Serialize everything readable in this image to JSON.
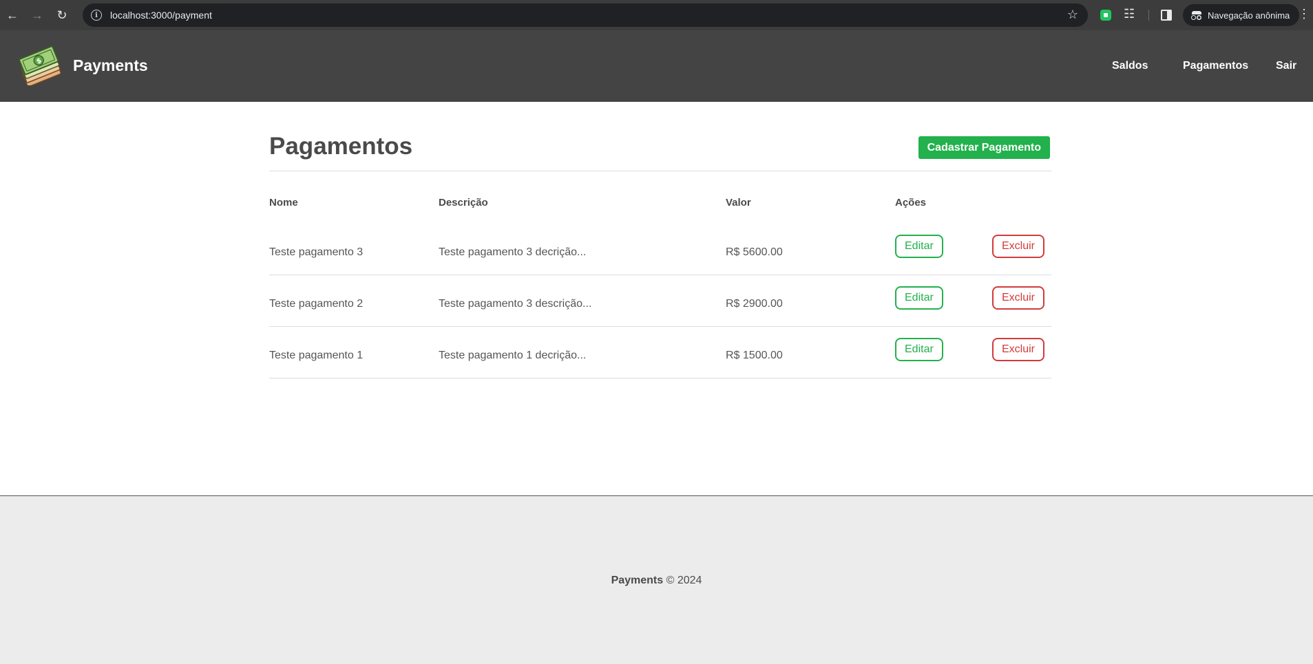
{
  "browser": {
    "url": "localhost:3000/payment",
    "profile_label": "Navegação anônima"
  },
  "header": {
    "brand": "Payments",
    "nav": [
      "Saldos",
      "Pagamentos",
      "Sair"
    ]
  },
  "main": {
    "title": "Pagamentos",
    "add_button": "Cadastrar Pagamento",
    "columns": [
      "Nome",
      "Descrição",
      "Valor",
      "Ações"
    ],
    "rows": [
      {
        "nome": "Teste pagamento 3",
        "descricao": "Teste pagamento 3 decrição...",
        "valor": "R$ 5600.00",
        "edit": "Editar",
        "delete": "Excluir"
      },
      {
        "nome": "Teste pagamento 2",
        "descricao": "Teste pagamento 3 descrição...",
        "valor": "R$ 2900.00",
        "edit": "Editar",
        "delete": "Excluir"
      },
      {
        "nome": "Teste pagamento 1",
        "descricao": "Teste pagamento 1 decrição...",
        "valor": "R$ 1500.00",
        "edit": "Editar",
        "delete": "Excluir"
      }
    ]
  },
  "footer": {
    "brand": "Payments",
    "copyright": "© 2024"
  },
  "colors": {
    "header_bg": "#444444",
    "success": "#22b14c",
    "danger": "#d33a3a",
    "footer_bg": "#ececec"
  }
}
